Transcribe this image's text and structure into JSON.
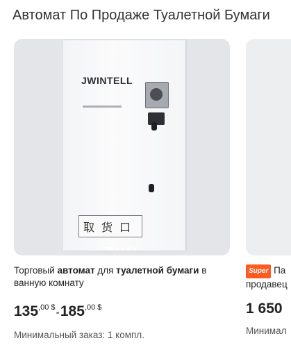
{
  "page": {
    "title": "Автомат По Продаже Туалетной Бумаги"
  },
  "products": [
    {
      "image_text": {
        "brand": "JWINTELL",
        "window_label": "取货口"
      },
      "title_parts": [
        "Торговый ",
        "автомат",
        " для ",
        "туалетной бумаги",
        " в ванную комнату"
      ],
      "price": {
        "min_int": "135",
        "min_dec": ",00",
        "currency": "$",
        "separator": "-",
        "max_int": "185",
        "max_dec": ",00"
      },
      "min_order": "Минимальный заказ: 1 компл."
    },
    {
      "badge": "Super",
      "title_line1": " Па",
      "title_line2": "продавец",
      "price_int": "1 650",
      "min_order": "Минимал"
    }
  ],
  "carousel": {
    "count": 5,
    "active": 1
  }
}
